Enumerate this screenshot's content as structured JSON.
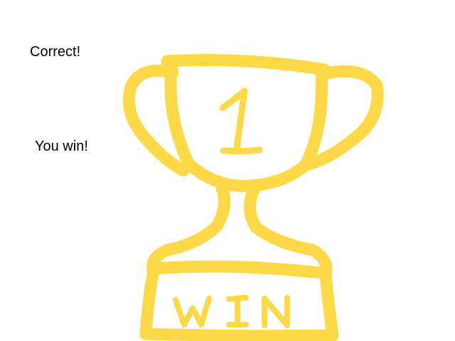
{
  "messages": {
    "correct": "Correct!",
    "you_win": "You win!"
  },
  "trophy": {
    "icon": "trophy-icon",
    "rank_number": "1",
    "base_label": "WIN"
  },
  "colors": {
    "trophy": "#FDD849",
    "text": "#000000",
    "background": "#FFFFFF"
  }
}
